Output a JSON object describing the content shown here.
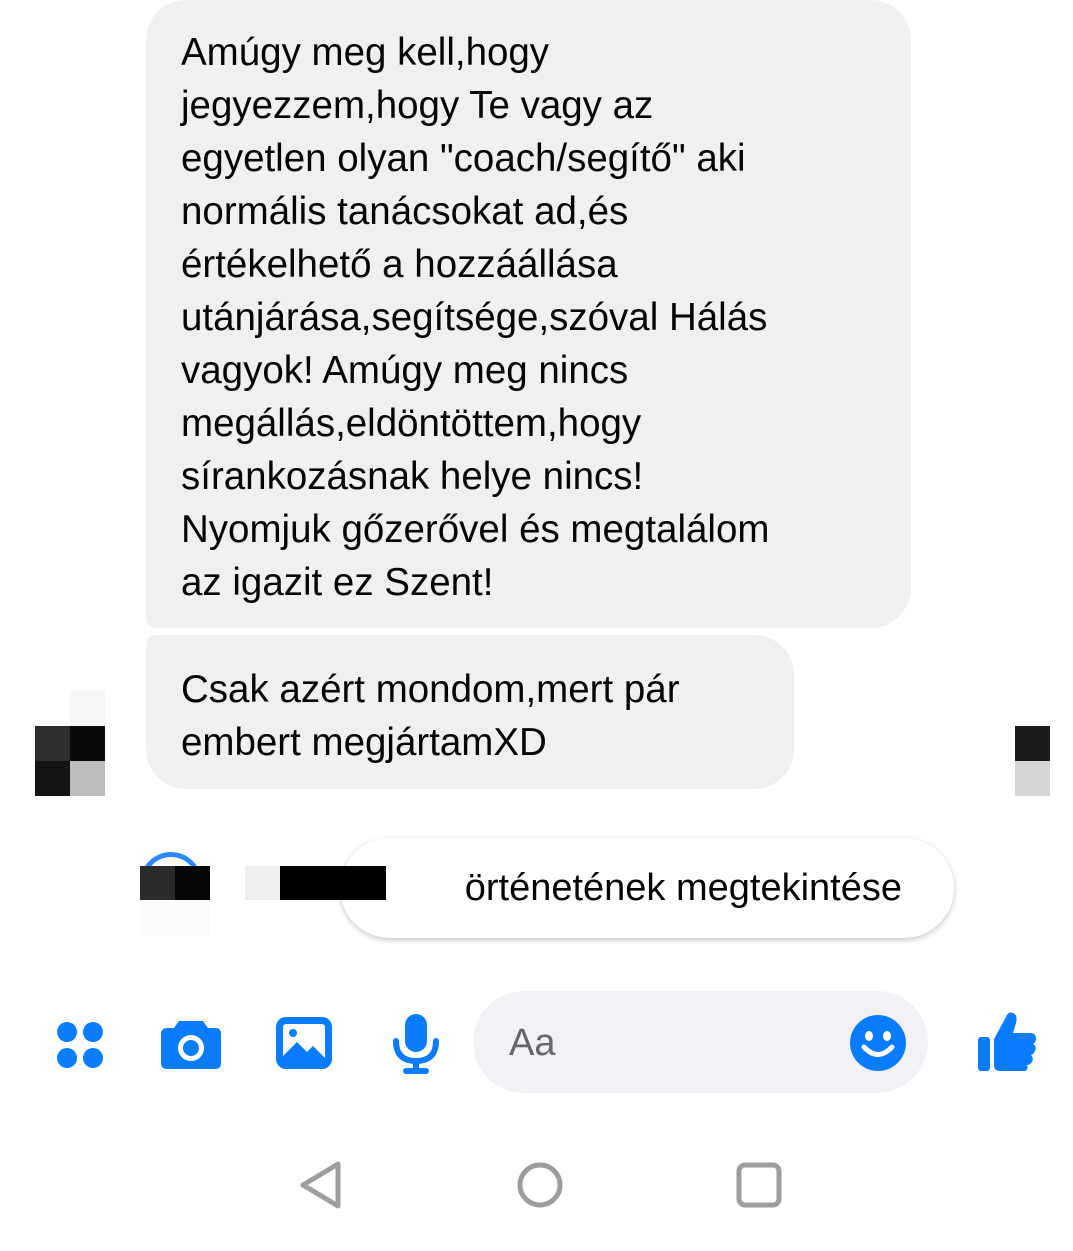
{
  "messages": [
    {
      "lines": [
        "Amúgy meg kell,hogy",
        "jegyezzem,hogy Te vagy az",
        "egyetlen olyan \"coach/segítő\" aki",
        "normális tanácsokat ad,és",
        "értékelhető a hozzáállása",
        "utánjárása,segítsége,szóval Hálás",
        "vagyok! Amúgy meg nincs",
        "megállás,eldöntöttem,hogy",
        "sírankozásnak helye nincs!",
        "Nyomjuk gőzerővel és megtalálom",
        "az igazit ez Szent!"
      ]
    },
    {
      "lines": [
        "Csak azért mondom,mert pár",
        "embert megjártamXD"
      ]
    }
  ],
  "story": {
    "label": "örténetének megtekintése"
  },
  "composer": {
    "placeholder": "Aa",
    "icons": [
      "menu-dots-icon",
      "camera-icon",
      "gallery-icon",
      "microphone-icon",
      "emoji-icon",
      "thumbs-up-icon"
    ]
  },
  "colors": {
    "accent": "#0a7cff",
    "bubble": "#f0f0f0",
    "nav": "#9e9e9e"
  }
}
